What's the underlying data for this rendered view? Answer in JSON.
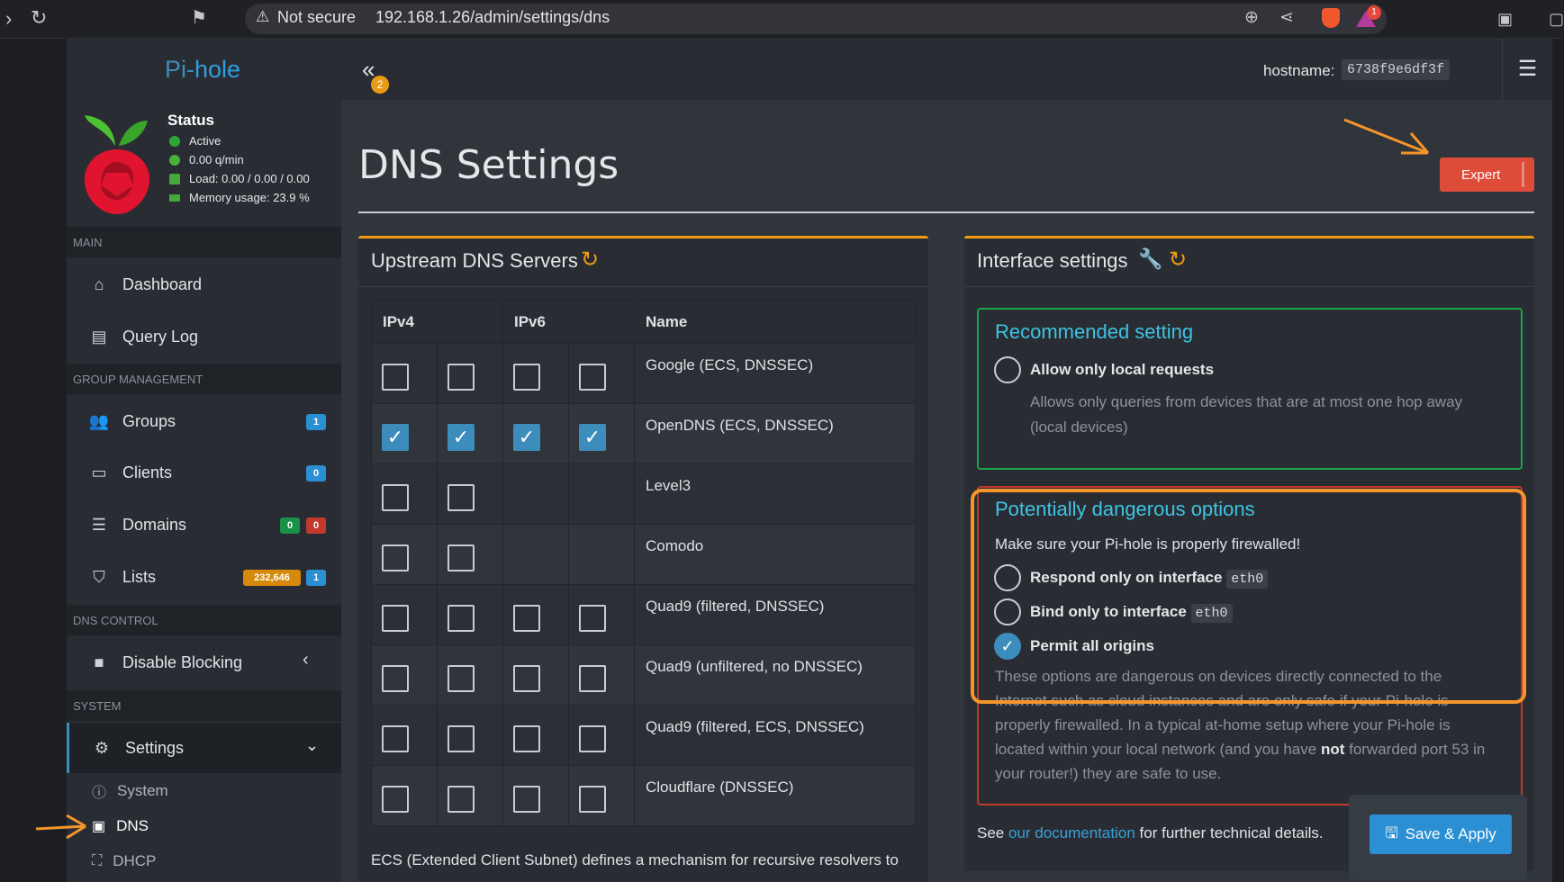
{
  "browser": {
    "security_label": "Not secure",
    "url": "192.168.1.26/admin/settings/dns",
    "extension_badge": "1"
  },
  "sidebar": {
    "logo_prefix": "Pi-",
    "logo_suffix": "hole",
    "status": {
      "title": "Status",
      "active": "Active",
      "queries": "0.00 q/min",
      "load": "Load: 0.00 / 0.00 / 0.00",
      "memory": "Memory usage: 23.9 %"
    },
    "sections": {
      "main": "MAIN",
      "group_management": "GROUP MANAGEMENT",
      "dns_control": "DNS CONTROL",
      "system": "SYSTEM"
    },
    "items": {
      "dashboard": "Dashboard",
      "query_log": "Query Log",
      "groups": "Groups",
      "groups_badge": "1",
      "clients": "Clients",
      "clients_badge": "0",
      "domains": "Domains",
      "domains_badge_allow": "0",
      "domains_badge_deny": "0",
      "lists": "Lists",
      "lists_badge_count": "232,646",
      "lists_badge_lists": "1",
      "disable_blocking": "Disable Blocking",
      "settings": "Settings",
      "system": "System",
      "dns": "DNS",
      "dhcp": "DHCP"
    }
  },
  "header": {
    "notification_count": "2",
    "hostname_label": "hostname:",
    "hostname_value": "6738f9e6df3f"
  },
  "page": {
    "title": "DNS Settings",
    "expert_button": "Expert"
  },
  "upstream": {
    "title": "Upstream DNS Servers",
    "columns": {
      "ipv4": "IPv4",
      "ipv6": "IPv6",
      "name": "Name"
    },
    "servers": [
      {
        "name": "Google (ECS, DNSSEC)",
        "checks": [
          false,
          false,
          false,
          false
        ]
      },
      {
        "name": "OpenDNS (ECS, DNSSEC)",
        "checks": [
          true,
          true,
          true,
          true
        ]
      },
      {
        "name": "Level3",
        "checks": [
          false,
          false
        ]
      },
      {
        "name": "Comodo",
        "checks": [
          false,
          false
        ]
      },
      {
        "name": "Quad9 (filtered, DNSSEC)",
        "checks": [
          false,
          false,
          false,
          false
        ]
      },
      {
        "name": "Quad9 (unfiltered, no DNSSEC)",
        "checks": [
          false,
          false,
          false,
          false
        ]
      },
      {
        "name": "Quad9 (filtered, ECS, DNSSEC)",
        "checks": [
          false,
          false,
          false,
          false
        ]
      },
      {
        "name": "Cloudflare (DNSSEC)",
        "checks": [
          false,
          false,
          false,
          false
        ]
      }
    ],
    "ecs_note": "ECS (Extended Client Subnet) defines a mechanism for recursive resolvers to"
  },
  "interface": {
    "title": "Interface settings",
    "recommended": {
      "title": "Recommended setting",
      "option_label": "Allow only local requests",
      "option_help_1": "Allows only queries from devices that are at most one hop away",
      "option_help_2": "(local devices)"
    },
    "dangerous": {
      "title": "Potentially dangerous options",
      "warning": "Make sure your Pi-hole is properly firewalled!",
      "opt1_label": "Respond only on interface",
      "opt1_iface": "eth0",
      "opt2_label": "Bind only to interface",
      "opt2_iface": "eth0",
      "opt3_label": "Permit all origins",
      "help_1": "These options are dangerous on devices directly connected to the",
      "help_2": "Internet such as cloud instances and are only safe if your Pi-hole is",
      "help_3": "properly firewalled. In a typical at-home setup where your Pi-hole is",
      "help_4a": "located within your local network (and you have ",
      "help_4b": "not",
      "help_4c": " forwarded port 53 in",
      "help_5": "your router!) they are safe to use."
    },
    "footer_see": "See",
    "footer_link": "our documentation",
    "footer_rest": "for further technical details."
  },
  "save_button": "Save & Apply",
  "colors": {
    "accent": "#3c8dbc",
    "annotation": "#f5952a",
    "danger": "#dd4b39",
    "box_top": "#f39c12",
    "success_border": "#18a348"
  }
}
